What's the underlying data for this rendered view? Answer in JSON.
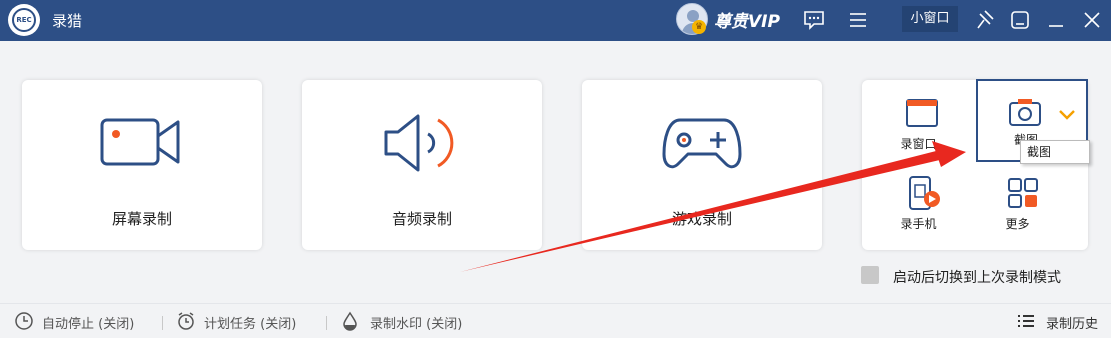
{
  "app": {
    "title": "录猎",
    "logo_text": "REC"
  },
  "titlebar": {
    "vip_label": "尊贵VIP",
    "mini_window_label": "小窗口",
    "icons": [
      "avatar-icon",
      "chat-icon",
      "menu-icon",
      "pin-icon",
      "skin-icon",
      "minimize-icon",
      "close-icon"
    ]
  },
  "modes": [
    {
      "label": "屏幕录制",
      "icon": "screen-record-icon"
    },
    {
      "label": "音频录制",
      "icon": "audio-record-icon"
    },
    {
      "label": "游戏录制",
      "icon": "game-record-icon"
    }
  ],
  "multi": {
    "window_label": "录窗口",
    "screenshot_label": "截图",
    "phone_label": "录手机",
    "more_label": "更多",
    "tooltip": "截图"
  },
  "option": {
    "restore_last_mode": "启动后切换到上次录制模式",
    "checked": false
  },
  "bottombar": {
    "auto_stop": "自动停止 (关闭)",
    "schedule": "计划任务 (关闭)",
    "watermark": "录制水印 (关闭)",
    "history": "录制历史"
  },
  "colors": {
    "titlebar": "#2d4f86",
    "accent": "#f15a24",
    "icon_stroke": "#2d4f86",
    "annotation_arrow": "#e8281f"
  }
}
